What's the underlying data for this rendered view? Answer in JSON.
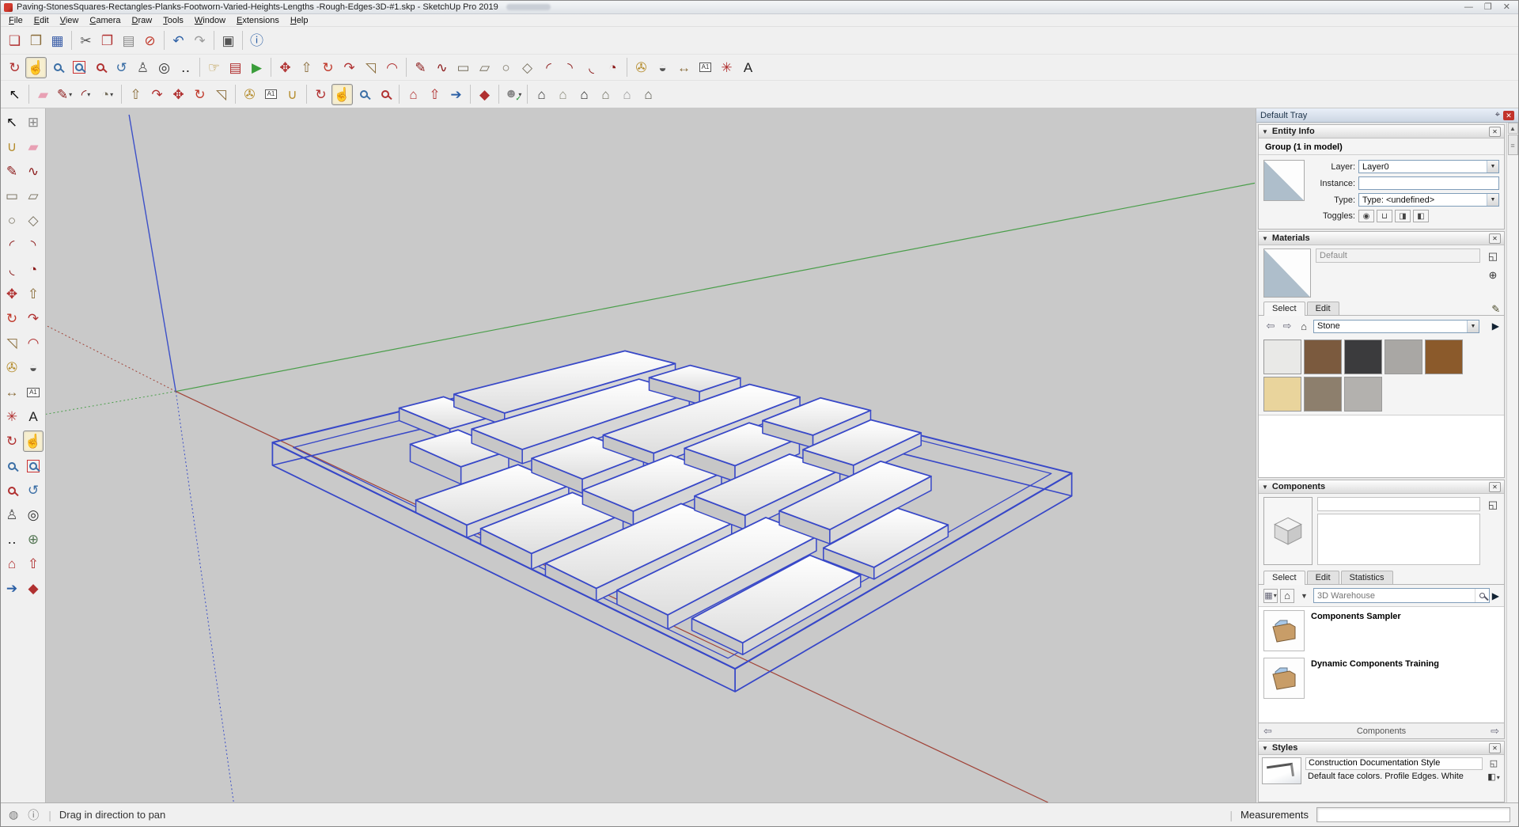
{
  "window": {
    "title": "Paving-StonesSquares-Rectangles-Planks-Footworn-Varied-Heights-Lengths -Rough-Edges-3D-#1.skp - SketchUp Pro 2019",
    "minimize_glyph": "—",
    "restore_glyph": "❐",
    "close_glyph": "✕"
  },
  "menu": {
    "items": [
      "File",
      "Edit",
      "View",
      "Camera",
      "Draw",
      "Tools",
      "Window",
      "Extensions",
      "Help"
    ]
  },
  "colors": {
    "selection_blue": "#3848c8",
    "axis_red": "#a04338",
    "axis_green": "#4a9e4a",
    "axis_blue": "#3c50c8",
    "viewport_bg": "#c9c9c9"
  },
  "toolbar_row1": [
    {
      "name": "new-file",
      "glyph": "❏",
      "color": "#b03030"
    },
    {
      "name": "open-file",
      "glyph": "❒",
      "color": "#8a6d3b"
    },
    {
      "name": "save-file",
      "glyph": "▦",
      "color": "#3b5ea8"
    },
    {
      "sep": true
    },
    {
      "name": "cut",
      "glyph": "✂",
      "color": "#555555"
    },
    {
      "name": "copy",
      "glyph": "❐",
      "color": "#b03030"
    },
    {
      "name": "paste",
      "glyph": "▤",
      "color": "#8a8a8a"
    },
    {
      "name": "erase",
      "glyph": "⊘",
      "color": "#c0392b"
    },
    {
      "sep": true
    },
    {
      "name": "undo",
      "glyph": "↶",
      "color": "#2b5fa5"
    },
    {
      "name": "redo",
      "glyph": "↷",
      "color": "#9a9a9a"
    },
    {
      "sep": true
    },
    {
      "name": "print",
      "glyph": "▣",
      "color": "#555555"
    },
    {
      "sep": true
    },
    {
      "name": "model-info",
      "glyph": "ⓘ",
      "color": "#2b5fa5"
    }
  ],
  "toolbar_row2": [
    {
      "name": "orbit",
      "glyph": "↻",
      "color": "#b03030"
    },
    {
      "name": "pan",
      "glyph": "☝",
      "color": "#b58d2e",
      "active": true
    },
    {
      "name": "zoom",
      "type": "mag",
      "color": "#3a6ea5"
    },
    {
      "name": "zoom-window",
      "type": "magbox",
      "color": "#3a6ea5"
    },
    {
      "name": "zoom-extents",
      "type": "mag",
      "color": "#b03030"
    },
    {
      "name": "zoom-previous",
      "glyph": "↺",
      "color": "#3a6ea5"
    },
    {
      "name": "position-camera",
      "glyph": "♙",
      "color": "#555555"
    },
    {
      "name": "look-around",
      "glyph": "◎",
      "color": "#333333"
    },
    {
      "name": "walk",
      "glyph": "‥",
      "color": "#222222"
    },
    {
      "sep": true
    },
    {
      "name": "interact",
      "glyph": "☞",
      "color": "#b58d2e"
    },
    {
      "name": "component-options",
      "glyph": "▤",
      "color": "#b03030"
    },
    {
      "name": "component-attributes",
      "glyph": "▶",
      "color": "#3a9d3a"
    },
    {
      "sep": true
    },
    {
      "name": "move",
      "glyph": "✥",
      "color": "#b03030"
    },
    {
      "name": "push-pull",
      "glyph": "⇧",
      "color": "#8a6d3b"
    },
    {
      "name": "rotate",
      "glyph": "↻",
      "color": "#c0392b"
    },
    {
      "name": "follow-me",
      "glyph": "↷",
      "color": "#b03030"
    },
    {
      "name": "scale",
      "glyph": "◹",
      "color": "#8a6d3b"
    },
    {
      "name": "offset",
      "glyph": "◠",
      "color": "#b03030"
    },
    {
      "sep": true
    },
    {
      "name": "line",
      "glyph": "✎",
      "color": "#8b1a1a"
    },
    {
      "name": "freehand",
      "glyph": "∿",
      "color": "#8b1a1a"
    },
    {
      "name": "rectangle",
      "glyph": "▭",
      "color": "#77705e"
    },
    {
      "name": "rotated-rectangle",
      "glyph": "▱",
      "color": "#77705e"
    },
    {
      "name": "circle",
      "glyph": "○",
      "color": "#77705e"
    },
    {
      "name": "polygon",
      "glyph": "◇",
      "color": "#77705e"
    },
    {
      "name": "arc",
      "glyph": "◜",
      "color": "#8b1a1a"
    },
    {
      "name": "two-point-arc",
      "glyph": "◝",
      "color": "#8b1a1a"
    },
    {
      "name": "three-point-arc",
      "glyph": "◟",
      "color": "#8b1a1a"
    },
    {
      "name": "pie",
      "glyph": "◔",
      "color": "#8b1a1a"
    },
    {
      "sep": true
    },
    {
      "name": "tape-measure",
      "glyph": "✇",
      "color": "#b58d2e"
    },
    {
      "name": "protractor",
      "glyph": "◒",
      "color": "#555555"
    },
    {
      "name": "dimension",
      "glyph": "↔",
      "color": "#8a6d3b"
    },
    {
      "name": "text",
      "type": "boxtext",
      "glyph": "A1"
    },
    {
      "name": "axes",
      "glyph": "✳",
      "color": "#b03030"
    },
    {
      "name": "3d-text",
      "glyph": "A",
      "color": "#222222"
    }
  ],
  "toolbar_row3": [
    {
      "name": "select",
      "glyph": "↖",
      "color": "#111111"
    },
    {
      "sep": true
    },
    {
      "name": "eraser",
      "glyph": "▰",
      "color": "#e8a0b4"
    },
    {
      "name": "line",
      "glyph": "✎",
      "color": "#8b1a1a",
      "dd": true
    },
    {
      "name": "arc",
      "glyph": "◜",
      "color": "#8b1a1a",
      "dd": true
    },
    {
      "name": "shapes",
      "glyph": "◔",
      "color": "#77705e",
      "dd": true
    },
    {
      "sep": true
    },
    {
      "name": "push-pull",
      "glyph": "⇧",
      "color": "#8a6d3b"
    },
    {
      "name": "follow-me",
      "glyph": "↷",
      "color": "#b03030"
    },
    {
      "name": "move",
      "glyph": "✥",
      "color": "#b03030"
    },
    {
      "name": "rotate",
      "glyph": "↻",
      "color": "#c0392b"
    },
    {
      "name": "scale",
      "glyph": "◹",
      "color": "#8a6d3b"
    },
    {
      "sep": true
    },
    {
      "name": "tape-measure",
      "glyph": "✇",
      "color": "#b58d2e"
    },
    {
      "name": "text",
      "type": "boxtext",
      "glyph": "A1"
    },
    {
      "name": "paint-bucket",
      "glyph": "∪",
      "color": "#b58d2e"
    },
    {
      "sep": true
    },
    {
      "name": "orbit",
      "glyph": "↻",
      "color": "#b03030"
    },
    {
      "name": "pan",
      "glyph": "☝",
      "color": "#b58d2e",
      "active": true
    },
    {
      "name": "zoom",
      "type": "mag",
      "color": "#3a6ea5"
    },
    {
      "name": "zoom-extents",
      "type": "mag",
      "color": "#b03030"
    },
    {
      "sep": true
    },
    {
      "name": "3d-warehouse",
      "glyph": "⌂",
      "color": "#b03030"
    },
    {
      "name": "share-model",
      "glyph": "⇧",
      "color": "#b03030"
    },
    {
      "name": "share-component",
      "glyph": "➔",
      "color": "#2b5fa5"
    },
    {
      "sep": true
    },
    {
      "name": "extension-warehouse",
      "glyph": "◆",
      "color": "#b03030"
    },
    {
      "sep": true
    },
    {
      "name": "account",
      "type": "avatar",
      "dd": true
    },
    {
      "sep": true
    },
    {
      "name": "view-iso",
      "glyph": "⌂",
      "color": "#333333"
    },
    {
      "name": "view-top",
      "glyph": "⌂",
      "color": "#8a8a7a"
    },
    {
      "name": "view-front",
      "glyph": "⌂",
      "color": "#222222"
    },
    {
      "name": "view-right",
      "glyph": "⌂",
      "color": "#6f6f5f"
    },
    {
      "name": "view-back",
      "glyph": "⌂",
      "color": "#9a9a9a"
    },
    {
      "name": "view-left",
      "glyph": "⌂",
      "color": "#55554a"
    }
  ],
  "left_toolbar": [
    {
      "name": "select",
      "glyph": "↖",
      "color": "#111111"
    },
    {
      "name": "make-component",
      "glyph": "⊞",
      "color": "#8a8a8a"
    },
    {
      "name": "paint-bucket",
      "glyph": "∪",
      "color": "#b58d2e"
    },
    {
      "name": "eraser",
      "glyph": "▰",
      "color": "#e8a0b4"
    },
    {
      "name": "line",
      "glyph": "✎",
      "color": "#8b1a1a"
    },
    {
      "name": "freehand",
      "glyph": "∿",
      "color": "#8b1a1a"
    },
    {
      "name": "rectangle",
      "glyph": "▭",
      "color": "#77705e"
    },
    {
      "name": "rotated-rectangle",
      "glyph": "▱",
      "color": "#77705e"
    },
    {
      "name": "circle",
      "glyph": "○",
      "color": "#77705e"
    },
    {
      "name": "polygon",
      "glyph": "◇",
      "color": "#77705e"
    },
    {
      "name": "arc",
      "glyph": "◜",
      "color": "#8b1a1a"
    },
    {
      "name": "two-point-arc",
      "glyph": "◝",
      "color": "#8b1a1a"
    },
    {
      "name": "three-point-arc",
      "glyph": "◟",
      "color": "#8b1a1a"
    },
    {
      "name": "pie",
      "glyph": "◔",
      "color": "#8b1a1a"
    },
    {
      "name": "move",
      "glyph": "✥",
      "color": "#b03030"
    },
    {
      "name": "push-pull",
      "glyph": "⇧",
      "color": "#8a6d3b"
    },
    {
      "name": "rotate",
      "glyph": "↻",
      "color": "#c0392b"
    },
    {
      "name": "follow-me",
      "glyph": "↷",
      "color": "#b03030"
    },
    {
      "name": "scale",
      "glyph": "◹",
      "color": "#8a6d3b"
    },
    {
      "name": "offset",
      "glyph": "◠",
      "color": "#b03030"
    },
    {
      "name": "tape-measure",
      "glyph": "✇",
      "color": "#b58d2e"
    },
    {
      "name": "protractor",
      "glyph": "◒",
      "color": "#555555"
    },
    {
      "name": "dimension",
      "glyph": "↔",
      "color": "#8a6d3b"
    },
    {
      "name": "text",
      "type": "boxtext",
      "glyph": "A1"
    },
    {
      "name": "axes",
      "glyph": "✳",
      "color": "#b03030"
    },
    {
      "name": "3d-text",
      "glyph": "A",
      "color": "#222222"
    },
    {
      "name": "orbit",
      "glyph": "↻",
      "color": "#b03030"
    },
    {
      "name": "pan",
      "glyph": "☝",
      "color": "#b58d2e",
      "active": true
    },
    {
      "name": "zoom",
      "type": "mag",
      "color": "#3a6ea5"
    },
    {
      "name": "zoom-window",
      "type": "magbox",
      "color": "#3a6ea5"
    },
    {
      "name": "zoom-extents",
      "type": "mag",
      "color": "#b03030"
    },
    {
      "name": "zoom-previous",
      "glyph": "↺",
      "color": "#3a6ea5"
    },
    {
      "name": "position-camera",
      "glyph": "♙",
      "color": "#555555"
    },
    {
      "name": "look-around",
      "glyph": "◎",
      "color": "#333333"
    },
    {
      "name": "walk",
      "glyph": "‥",
      "color": "#222222"
    },
    {
      "name": "section-plane",
      "glyph": "⊕",
      "color": "#557755"
    },
    {
      "name": "3d-warehouse",
      "glyph": "⌂",
      "color": "#b03030"
    },
    {
      "name": "share-model",
      "glyph": "⇧",
      "color": "#b03030"
    },
    {
      "name": "share-component",
      "glyph": "➔",
      "color": "#2b5fa5"
    },
    {
      "name": "extension-warehouse",
      "glyph": "◆",
      "color": "#b03030"
    }
  ],
  "tray": {
    "title": "Default Tray",
    "entity_info": {
      "title": "Entity Info",
      "summary": "Group (1 in model)",
      "layer_label": "Layer:",
      "layer_value": "Layer0",
      "instance_label": "Instance:",
      "instance_value": "",
      "type_label": "Type:",
      "type_value": "Type: <undefined>",
      "toggles_label": "Toggles:",
      "toggles": [
        {
          "name": "visible-toggle",
          "glyph": "◉"
        },
        {
          "name": "lock-toggle",
          "glyph": "⊔"
        },
        {
          "name": "cast-shadows-toggle",
          "glyph": "◨"
        },
        {
          "name": "receive-shadows-toggle",
          "glyph": "◧"
        }
      ]
    },
    "materials": {
      "title": "Materials",
      "preview_name": "Default",
      "tabs": [
        "Select",
        "Edit"
      ],
      "collection": "Stone",
      "swatches": [
        {
          "name": "marble-white",
          "color": "#e9e9e7"
        },
        {
          "name": "granite-brown",
          "color": "#7b5a3e"
        },
        {
          "name": "charcoal",
          "color": "#3b3b3d"
        },
        {
          "name": "concrete-gray",
          "color": "#a9a7a4"
        },
        {
          "name": "brown",
          "color": "#8b5a2b"
        },
        {
          "name": "travertine-tan",
          "color": "#e9d49c"
        },
        {
          "name": "rock-moss",
          "color": "#8d7f6d"
        },
        {
          "name": "stone-gray",
          "color": "#b3b1ae"
        }
      ]
    },
    "components": {
      "title": "Components",
      "tabs": [
        "Select",
        "Edit",
        "Statistics"
      ],
      "search_placeholder": "3D Warehouse",
      "items": [
        "Components Sampler",
        "Dynamic Components Training"
      ],
      "nav_label": "Components"
    },
    "styles": {
      "title": "Styles",
      "style_name": "Construction Documentation Style",
      "style_desc": "Default face colors. Profile Edges. White"
    }
  },
  "statusbar": {
    "hint": "Drag in direction to pan",
    "measurements_label": "Measurements",
    "measurements_value": ""
  }
}
